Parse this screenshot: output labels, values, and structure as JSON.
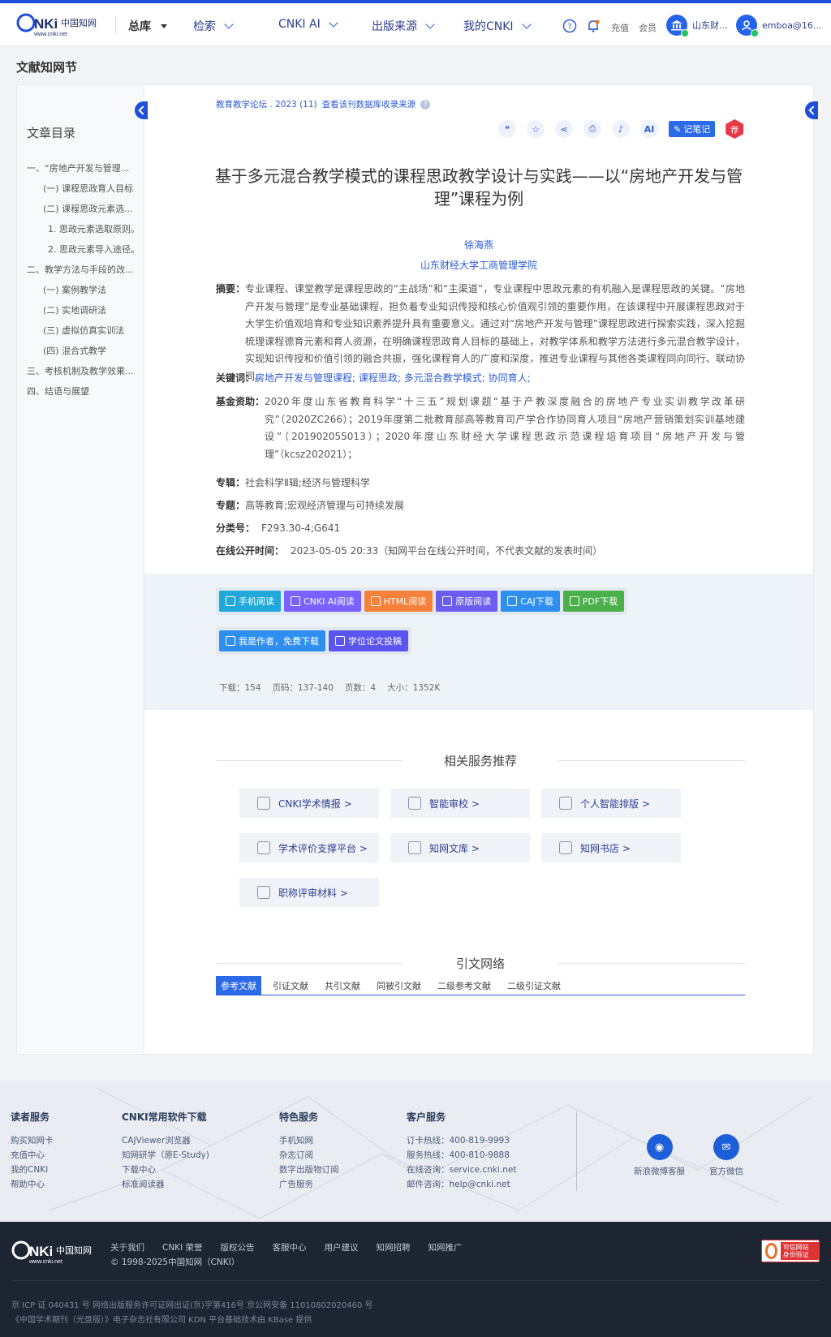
{
  "header": {
    "logo_text": "CNKI 中国知网 www.cnki.net",
    "nav": [
      {
        "label": "总库"
      },
      {
        "label": "检索"
      },
      {
        "label": "CNKI AI"
      },
      {
        "label": "出版来源"
      },
      {
        "label": "我的CNKI"
      }
    ],
    "recharge_label": "充值",
    "member_label": "会员",
    "institution_label": "山东财...",
    "user_label": "emboa@16..."
  },
  "page_title": "文献知网节",
  "sidebar": {
    "title": "文章目录",
    "items": [
      "一、“房地产开发与管理...",
      "(一) 课程思政育人目标",
      "(二) 课程思政元素选...",
      "1. 思政元素选取原则。",
      "2. 思政元素导入途径。",
      "二、教学方法与手段的改...",
      "(一) 案例教学法",
      "(二) 实地调研法",
      "(三) 虚拟仿真实训法",
      "(四) 混合式教学",
      "三、考核机制及教学效果...",
      "四、结语与展望"
    ]
  },
  "article": {
    "source": "教育教学论坛 . 2023 (11)",
    "source_link": "查看该刊数据库收录来源",
    "toolbar": {
      "cite_icon": "quote-icon",
      "fav_icon": "star-icon",
      "share_icon": "share-icon",
      "print_icon": "print-icon",
      "notify_icon": "bell-icon",
      "ai_label": "AI",
      "note_label": "记笔记",
      "rec_label": "荐"
    },
    "title": "基于多元混合教学模式的课程思政教学设计与实践——以“房地产开发与管理”课程为例",
    "author": "徐海燕",
    "affiliation": "山东财经大学工商管理学院",
    "abstract_label": "摘要：",
    "abstract": "专业课程、课堂教学是课程思政的“主战场”和“主渠道”，专业课程中思政元素的有机融入是课程思政的关键。“房地产开发与管理”是专业基础课程，担负着专业知识传授和核心价值观引领的重要作用，在该课程中开展课程思政对于大学生价值观培育和专业知识素养提升具有重要意义。通过对“房地产开发与管理”课程思政进行探索实践，深入挖掘梳理课程德育元素和育人资源，在明确课程思政育人目标的基础上，对教学体系和教学方法进行多元混合教学设计，实现知识传授和价值引领的融合共振，强化课程育人的广度和深度，推进专业课程与其他各类课程同向同行、联动协同。",
    "keywords_label": "关键词：",
    "keywords": [
      "房地产开发与管理课程;",
      "课程思政;",
      "多元混合教学模式;",
      "协同育人;"
    ],
    "fund_label": "基金资助：",
    "fund": "2020年度山东省教育科学“十三五”规划课题“基于产教深度融合的房地产专业实训教学改革研究”（2020ZC266）；2019年度第二批教育部高等教育司产学合作协同育人项目“房地产营销策划实训基地建设”（201902055013）；2020年度山东财经大学课程思政示范课程培育项目“房地产开发与管理”（kcsz202021）；",
    "album_label": "专辑：",
    "album": "社会科学Ⅱ辑;经济与管理科学",
    "topic_label": "专题：",
    "topic": "高等教育;宏观经济管理与可持续发展",
    "class_label": "分类号：",
    "class": "F293.30-4;G641",
    "pubtime_label": "在线公开时间：",
    "pubtime": "2023-05-05 20:33（知网平台在线公开时间，不代表文献的发表时间）"
  },
  "downloads": {
    "buttons": [
      {
        "label": "手机阅读",
        "color": "#1fa8d8"
      },
      {
        "label": "CNKI AI阅读",
        "color": "#7b61ff"
      },
      {
        "label": "HTML阅读",
        "color": "#f5813a"
      },
      {
        "label": "原版阅读",
        "color": "#6a5df0"
      },
      {
        "label": "CAJ下载",
        "color": "#2f8ff0"
      },
      {
        "label": "PDF下载",
        "color": "#4bb04a"
      }
    ],
    "buttons2": [
      {
        "label": "我是作者，免费下载",
        "color": "#2f8ff0"
      },
      {
        "label": "学位论文投稿",
        "color": "#5b54f0"
      }
    ],
    "stats": [
      "下载：154",
      "页码：137-140",
      "页数：4",
      "大小：1352K"
    ]
  },
  "services": {
    "title": "相关服务推荐",
    "items": [
      "CNKI学术情报 >",
      "智能审校 >",
      "个人智能排版 >",
      "学术评价支撑平台 >",
      "知网文库 >",
      "知网书店 >",
      "职称评审材料 >"
    ]
  },
  "citation": {
    "title": "引文网络",
    "tabs": [
      "参考文献",
      "引证文献",
      "共引文献",
      "同被引文献",
      "二级参考文献",
      "二级引证文献"
    ]
  },
  "footer": {
    "cols": [
      {
        "h": "读者服务",
        "l": [
          "购买知网卡",
          "充值中心",
          "我的CNKI",
          "帮助中心"
        ]
      },
      {
        "h": "CNKI常用软件下载",
        "l": [
          "CAJViewer浏览器",
          "知网研学（原E-Study)",
          "下载中心",
          "标准阅读器"
        ]
      },
      {
        "h": "特色服务",
        "l": [
          "手机知网",
          "杂志订阅",
          "数字出版物订阅",
          "广告服务"
        ]
      },
      {
        "h": "客户服务",
        "l": [
          "订卡热线：400-819-9993",
          "服务热线：400-810-9888",
          "在线咨询：service.cnki.net",
          "邮件咨询：help@cnki.net"
        ]
      }
    ],
    "weibo": "新浪微博客服",
    "wechat": "官方微信",
    "links": [
      "关于我们",
      "CNKI 荣誉",
      "版权公告",
      "客服中心",
      "用户建议",
      "知网招聘",
      "知网推广"
    ],
    "copyright": "© 1998-2025中国知网（CNKI）",
    "icp1": "京 ICP 证 040431 号  网络出版服务许可证网出证(京)字第416号  京公网安备 11010802020460 号",
    "icp2": "《中国学术期刊（光盘版）》电子杂志社有限公司  KDN 平台基础技术由 KBase 提供",
    "trust": "可信网站 身份验证"
  }
}
